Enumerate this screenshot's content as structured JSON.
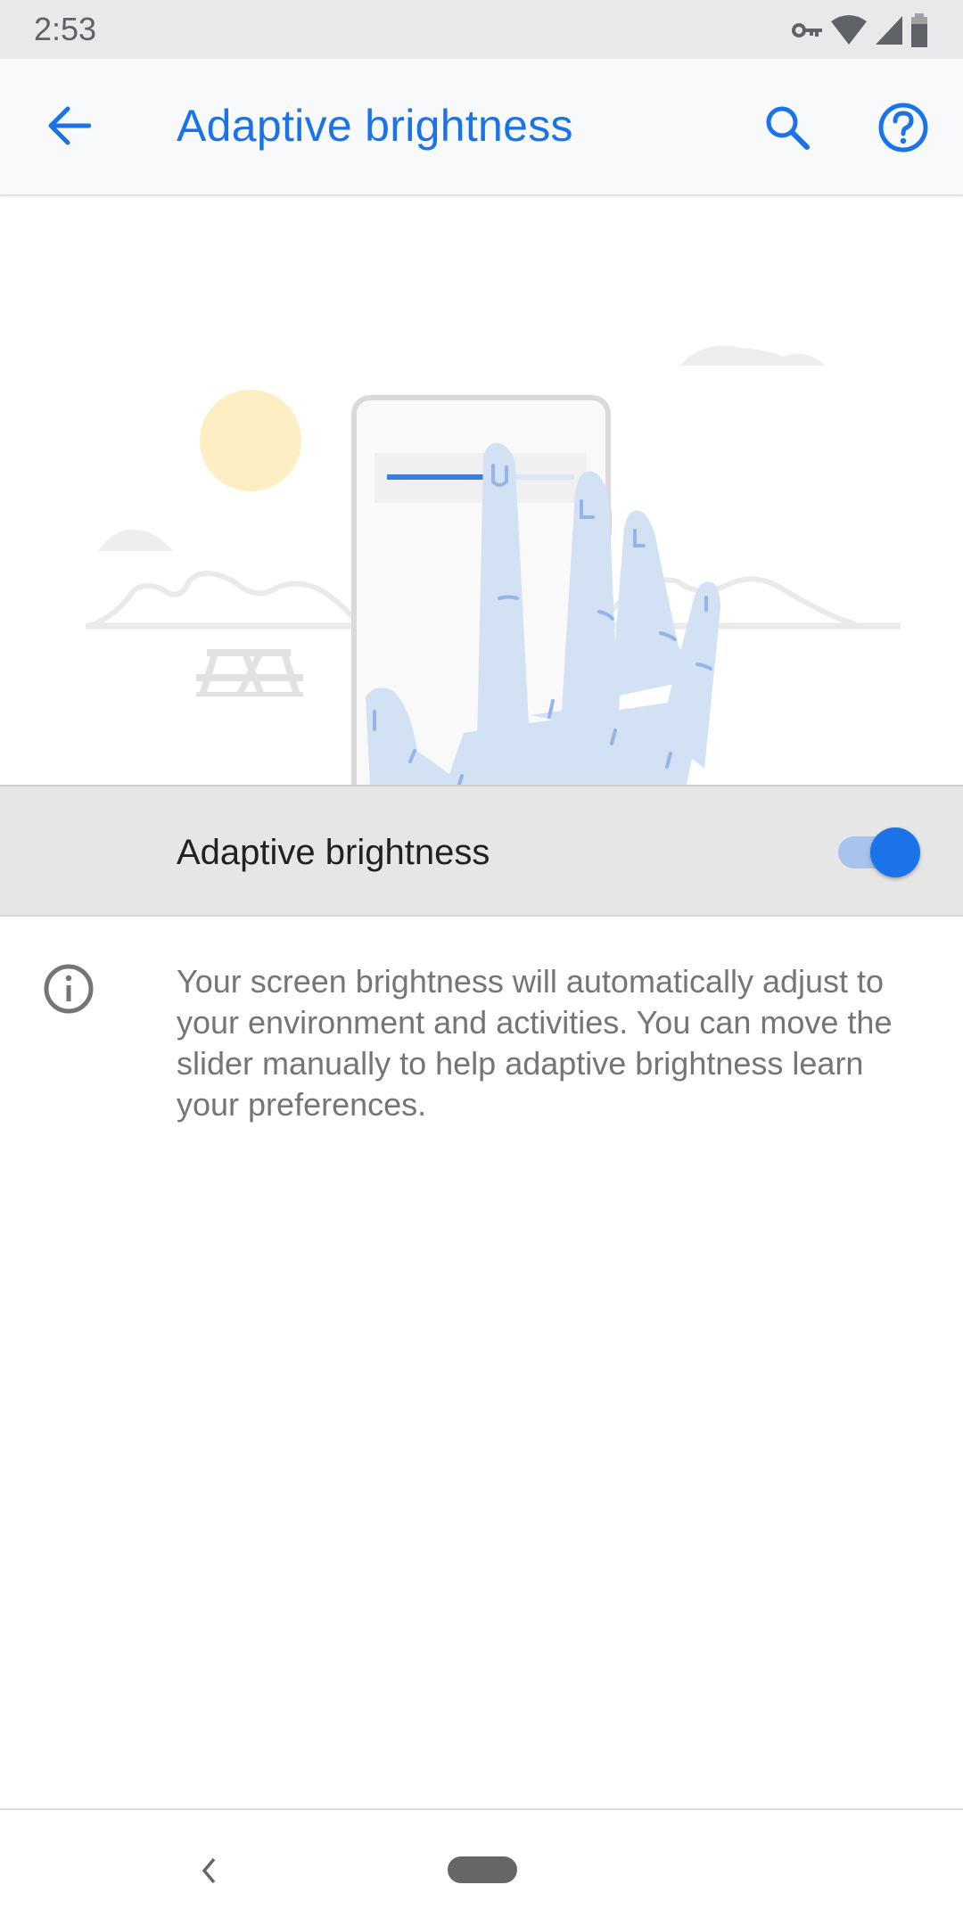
{
  "status_bar": {
    "time": "2:53",
    "icons": [
      "vpn-key-icon",
      "wifi-icon",
      "cellular-signal-icon",
      "battery-icon"
    ]
  },
  "app_bar": {
    "title": "Adaptive brightness",
    "back_icon": "arrow-back-icon",
    "search_icon": "search-icon",
    "help_icon": "help-circle-icon"
  },
  "illustration": {
    "description": "Hand adjusting brightness slider on phone with sun, clouds, hills and picnic table",
    "slider_level": 0.55
  },
  "toggle": {
    "label": "Adaptive brightness",
    "checked": true
  },
  "info": {
    "icon": "info-icon",
    "text": "Your screen brightness will automatically adjust to your environment and activities. You can move the slider manually to help adaptive brightness learn your preferences."
  },
  "nav_bar": {
    "back_icon": "nav-back-icon",
    "home_icon": "nav-home-pill-icon"
  },
  "colors": {
    "accent": "#1a73e8",
    "toggle_track": "#a8c3ec",
    "row_highlight": "#e6e6e6",
    "secondary_text": "#757575",
    "sun": "#fdefc3",
    "hand": "#d3e1f4"
  }
}
